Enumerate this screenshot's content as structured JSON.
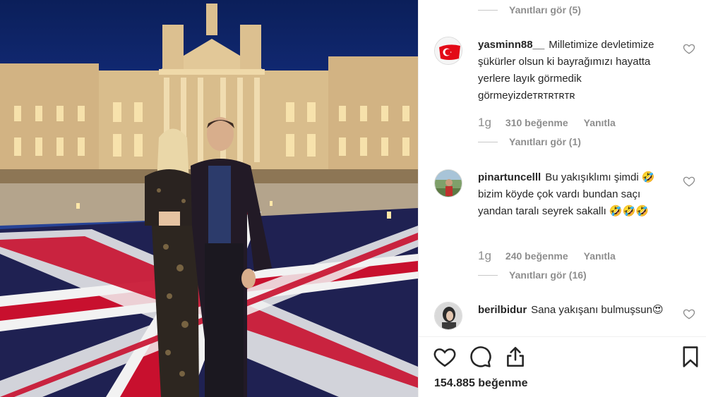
{
  "post": {
    "likes_total": "154.885 beğenme"
  },
  "comments": [
    {
      "username": "yasminn88__",
      "text": "Milletimize devletimize şükürler olsun ki bayrağımızı hayatta yerlere layık görmedik görmeyizdeᴛʀᴛʀᴛʀᴛʀ",
      "time": "1g",
      "likes": "310 beğenme",
      "reply_label": "Yanıtla",
      "view_replies": "Yanıtları gör (1)"
    },
    {
      "username": "pinartuncelll",
      "text": "Bu yakışıklımı şimdi 🤣 bizim köyde çok vardı bundan saçı yandan taralı seyrek sakallı 🤣🤣🤣",
      "time": "1g",
      "likes": "240 beğenme",
      "reply_label": "Yanıtla",
      "view_replies": "Yanıtları gör (16)"
    },
    {
      "username": "berilbidur",
      "text": "Sana yakışanı bulmuşsun😍"
    }
  ],
  "top_view_replies": "Yanıtları gör (5)",
  "icons": {
    "like": "heart-icon",
    "comment": "comment-icon",
    "share": "share-icon",
    "save": "bookmark-icon"
  },
  "colors": {
    "text": "#262626",
    "muted": "#8e8e8e",
    "divider": "#efefef",
    "flag_red": "#e30a17"
  }
}
